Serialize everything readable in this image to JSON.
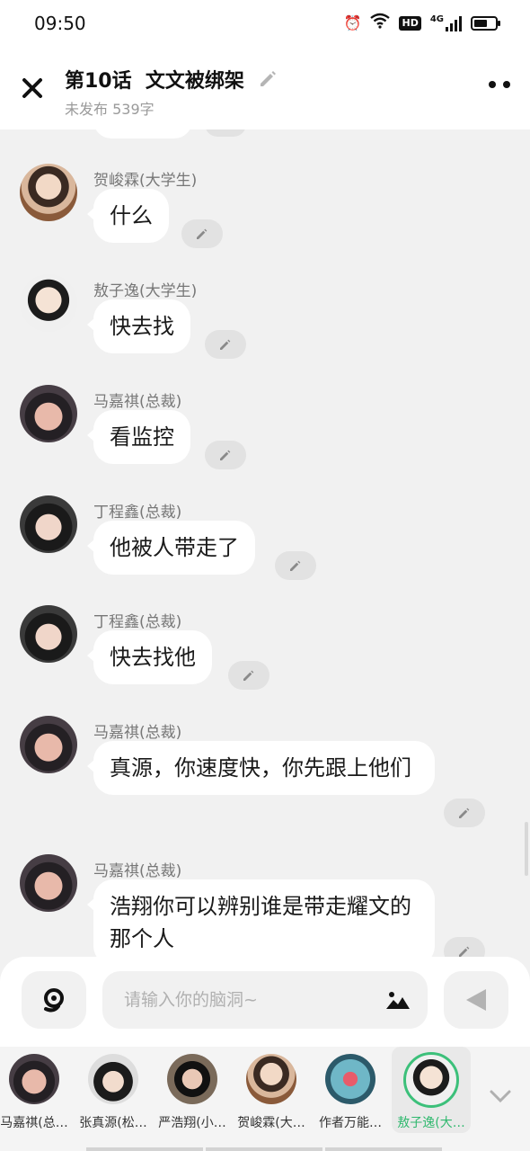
{
  "status_bar": {
    "time": "09:50",
    "network": "4G",
    "hd_badge": "HD"
  },
  "header": {
    "title": "第10话  文文被绑架",
    "subtitle": "未发布 539字"
  },
  "messages": [
    {
      "name": "贺峻霖(大学生)",
      "text": "什么"
    },
    {
      "name": "敖子逸(大学生)",
      "text": "快去找"
    },
    {
      "name": "马嘉祺(总裁)",
      "text": "看监控"
    },
    {
      "name": "丁程鑫(总裁)",
      "text": "他被人带走了"
    },
    {
      "name": "丁程鑫(总裁)",
      "text": "快去找他"
    },
    {
      "name": "马嘉祺(总裁)",
      "text": "真源，你速度快，你先跟上他们"
    },
    {
      "name": "马嘉祺(总裁)",
      "text": "浩翔你可以辨别谁是带走耀文的那个人"
    }
  ],
  "input": {
    "placeholder": "请输入你的脑洞~"
  },
  "characters": [
    {
      "label": "马嘉祺(总…"
    },
    {
      "label": "张真源(松…"
    },
    {
      "label": "严浩翔(小…"
    },
    {
      "label": "贺峻霖(大…"
    },
    {
      "label": "作者万能…"
    },
    {
      "label": "敖子逸(大…"
    }
  ],
  "colors": {
    "accent": "#2fb86e",
    "background": "#f1f1f1",
    "bubble": "#ffffff"
  }
}
